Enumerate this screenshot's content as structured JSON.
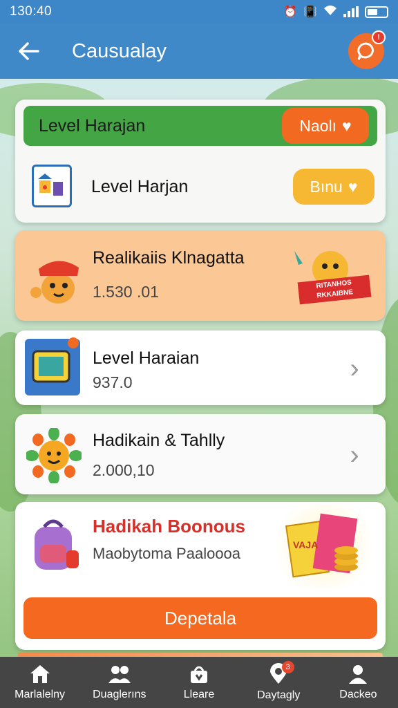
{
  "status_bar": {
    "time": "130:40",
    "icons": [
      "alarm-icon",
      "vibrate-icon",
      "wifi-icon",
      "signal-icon",
      "battery-icon"
    ]
  },
  "app_bar": {
    "title": "Causualay",
    "back_icon": "back-arrow-icon",
    "chat_icon": "chat-icon",
    "chat_badge": "!"
  },
  "top_card": {
    "green_row_label": "Level Harajan",
    "green_row_button": "Naolı",
    "second_row_label": "Level Harjan",
    "second_row_button": "Bınu"
  },
  "rows": [
    {
      "title": "Realikaiis Klnagatta",
      "value": "1.530 .01",
      "badge_text": "RITANHOS RKKAIBNE"
    },
    {
      "title": "Level Haraian",
      "value": "937.0"
    },
    {
      "title": "Hadikain & Tahlly",
      "value": "2.000,10"
    }
  ],
  "bonus": {
    "title": "Hadikah Boonous",
    "subtitle": "Maobytoma Paaloooa",
    "button": "Depetala",
    "pack_text": "VAJA"
  },
  "bottom_nav": [
    {
      "label": "Marlalelny",
      "icon": "home-icon"
    },
    {
      "label": "Duaglerıns",
      "icon": "people-icon"
    },
    {
      "label": "Lleare",
      "icon": "store-icon"
    },
    {
      "label": "Daytagly",
      "icon": "location-icon",
      "badge": "3"
    },
    {
      "label": "Dackeo",
      "icon": "profile-icon"
    }
  ],
  "colors": {
    "app_bar": "#3f89c9",
    "accent_orange": "#f26a21",
    "accent_green": "#43a544",
    "accent_yellow": "#f6b733",
    "nav_bg": "#454545"
  }
}
